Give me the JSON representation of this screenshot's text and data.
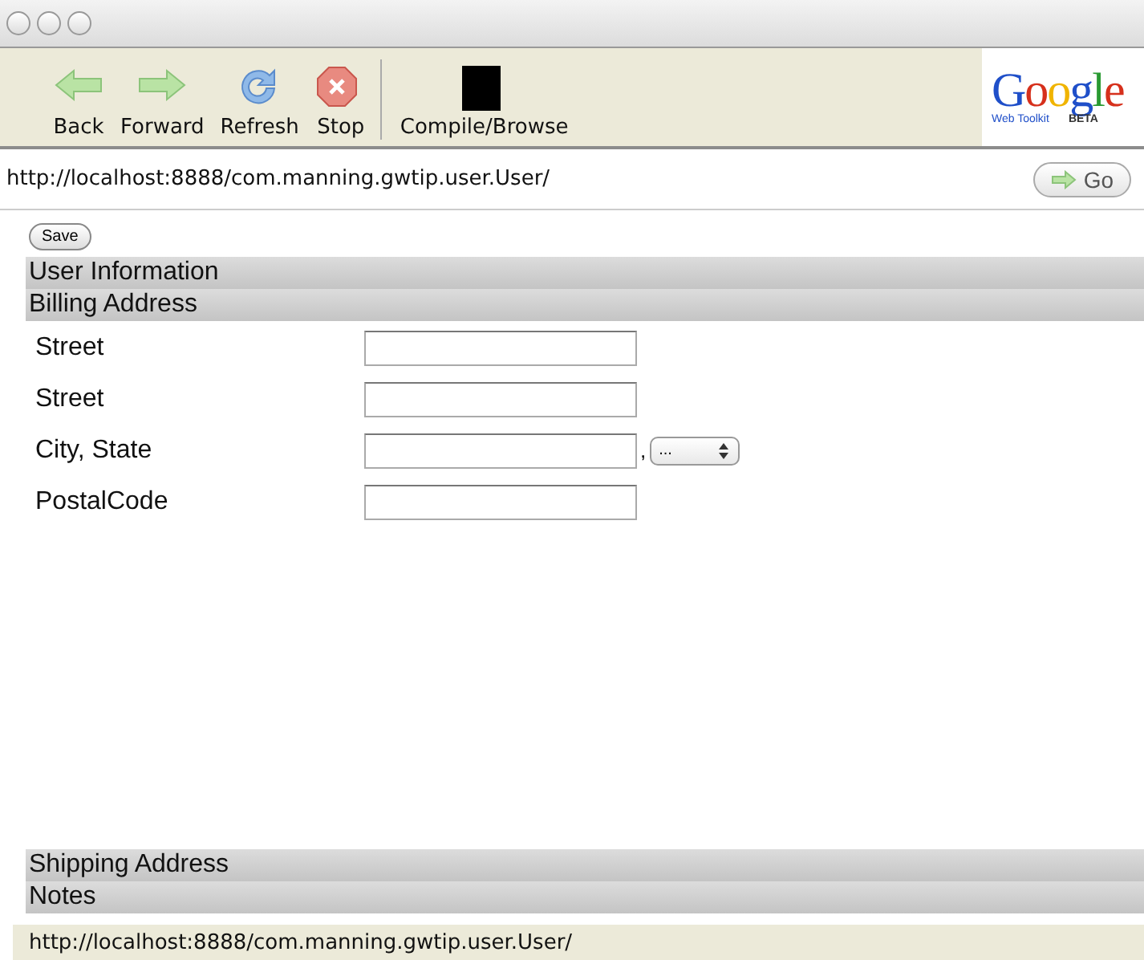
{
  "toolbar": {
    "buttons": [
      {
        "kind": "back",
        "label": "Back"
      },
      {
        "kind": "forward",
        "label": "Forward"
      },
      {
        "kind": "refresh",
        "label": "Refresh"
      },
      {
        "kind": "stop",
        "label": "Stop"
      },
      {
        "kind": "compile",
        "label": "Compile/Browse"
      }
    ],
    "logo": {
      "word": "Google",
      "subtitle": "Web Toolkit",
      "badge": "BETA"
    }
  },
  "address_bar": {
    "url": "http://localhost:8888/com.manning.gwtip.user.User/",
    "go_button": "Go"
  },
  "save_button": "Save",
  "sections": [
    {
      "title": "User Information"
    },
    {
      "title": "Billing Address",
      "fields": [
        {
          "kind": "text",
          "label": "Street"
        },
        {
          "kind": "text",
          "label": "Street"
        },
        {
          "kind": "city_state",
          "label": "City, State",
          "separator": ",",
          "select_value": "..."
        },
        {
          "kind": "text",
          "label": "PostalCode"
        }
      ]
    },
    {
      "title": "Shipping Address"
    },
    {
      "title": "Notes"
    }
  ],
  "status_bar": {
    "text": "http://localhost:8888/com.manning.gwtip.user.User/"
  }
}
